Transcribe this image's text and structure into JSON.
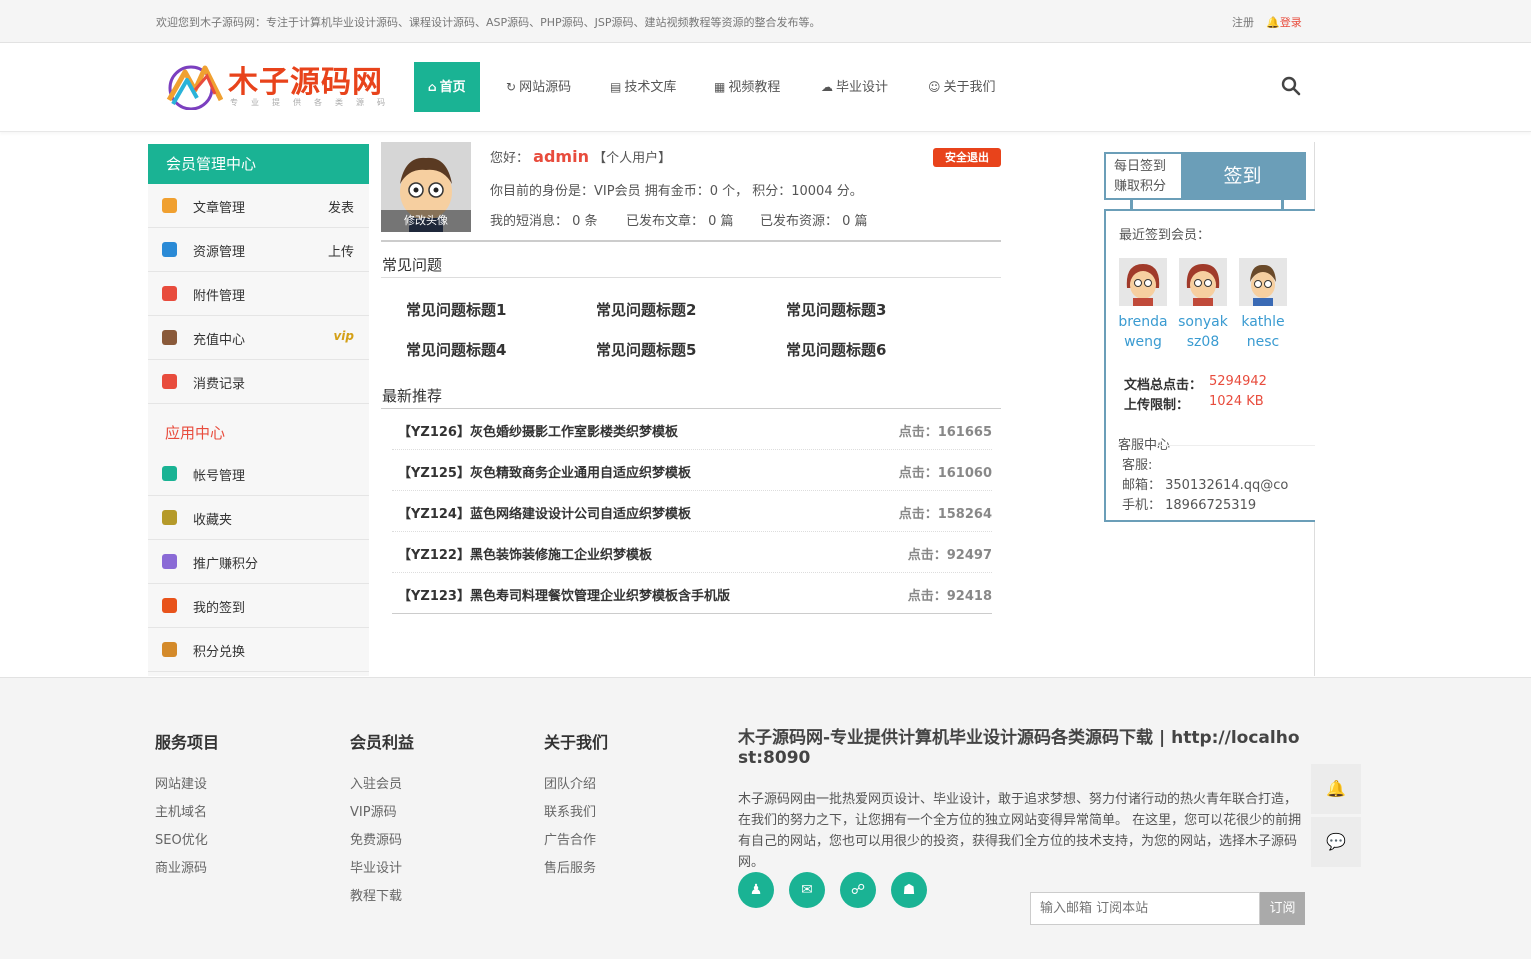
{
  "topbar": {
    "welcome": "欢迎您到木子源码网：专注于计算机毕业设计源码、课程设计源码、ASP源码、PHP源码、JSP源码、建站视频教程等资源的整合发布等。",
    "register": "注册",
    "login": "登录"
  },
  "header": {
    "logo_text": "木子源码网",
    "logo_sub": "专业提供各类源码",
    "nav": [
      {
        "label": "首页",
        "icon": "home-icon"
      },
      {
        "label": "网站源码",
        "icon": "refresh-icon"
      },
      {
        "label": "技术文库",
        "icon": "file-icon"
      },
      {
        "label": "视频教程",
        "icon": "film-icon"
      },
      {
        "label": "毕业设计",
        "icon": "cloud-icon"
      },
      {
        "label": "关于我们",
        "icon": "smile-icon"
      }
    ]
  },
  "sidebar": {
    "title": "会员管理中心",
    "items": [
      {
        "label": "文章管理",
        "right": "发表",
        "color": "#f0a030"
      },
      {
        "label": "资源管理",
        "right": "上传",
        "color": "#2a8ad6"
      },
      {
        "label": "附件管理",
        "right": "",
        "color": "#e84c3d"
      },
      {
        "label": "充值中心",
        "right": "vip",
        "color": "#8a5a3a"
      },
      {
        "label": "消费记录",
        "right": "",
        "color": "#e84c3d"
      }
    ],
    "app_title": "应用中心",
    "app_items": [
      {
        "label": "帐号管理",
        "color": "#1ab394"
      },
      {
        "label": "收藏夹",
        "color": "#b59a2a"
      },
      {
        "label": "推广赚积分",
        "color": "#8a6ad6"
      },
      {
        "label": "我的签到",
        "color": "#e8531b"
      },
      {
        "label": "积分兑换",
        "color": "#d48a2a"
      }
    ]
  },
  "profile": {
    "avatar_caption": "修改头像",
    "greeting": "您好：",
    "username": "admin",
    "user_type": "【个人用户】",
    "logout": "安全退出",
    "identity_line": "你目前的身份是：VIP会员 拥有金币：0 个， 积分：10004 分。",
    "messages": "我的短消息： 0 条",
    "articles": "已发布文章： 0 篇",
    "resources": "已发布资源： 0 篇"
  },
  "faq": {
    "title": "常见问题",
    "items": [
      "常见问题标题1",
      "常见问题标题2",
      "常见问题标题3",
      "常见问题标题4",
      "常见问题标题5",
      "常见问题标题6"
    ]
  },
  "recommend": {
    "title": "最新推荐",
    "rows": [
      {
        "title": "【YZ126】灰色婚纱摄影工作室影楼类织梦模板",
        "clicks": "点击：161665"
      },
      {
        "title": "【YZ125】灰色精致商务企业通用自适应织梦模板",
        "clicks": "点击：161060"
      },
      {
        "title": "【YZ124】蓝色网络建设设计公司自适应织梦模板",
        "clicks": "点击：158264"
      },
      {
        "title": "【YZ122】黑色装饰装修施工企业织梦模板",
        "clicks": "点击：92497"
      },
      {
        "title": "【YZ123】黑色寿司料理餐饮管理企业织梦模板含手机版",
        "clicks": "点击：92418"
      }
    ]
  },
  "signin": {
    "left_line1": "每日签到",
    "left_line2": "赚取积分",
    "button": "签到",
    "recent_title": "最近签到会员：",
    "members": [
      {
        "line1": "brenda",
        "line2": "weng"
      },
      {
        "line1": "sonyak",
        "line2": "sz08"
      },
      {
        "line1": "kathle",
        "line2": "nesc"
      }
    ],
    "stats": [
      {
        "label": "文档总点击：",
        "value": "5294942"
      },
      {
        "label": "上传限制：",
        "value": "1024 KB"
      }
    ],
    "service_title": "客服中心",
    "service_kf": "客服:",
    "service_email": "邮箱： 350132614.qq@co",
    "service_phone": "手机： 18966725319"
  },
  "footer": {
    "cols": [
      {
        "title": "服务项目",
        "links": [
          "网站建设",
          "主机域名",
          "SEO优化",
          "商业源码"
        ]
      },
      {
        "title": "会员利益",
        "links": [
          "入驻会员",
          "VIP源码",
          "免费源码",
          "毕业设计",
          "教程下载"
        ]
      },
      {
        "title": "关于我们",
        "links": [
          "团队介绍",
          "联系我们",
          "广告合作",
          "售后服务"
        ]
      }
    ],
    "about_title": "木子源码网-专业提供计算机毕业设计源码各类源码下载 | http://localhost:8090",
    "about_text": "木子源码网由一批热爱网页设计、毕业设计，敢于追求梦想、努力付诸行动的热火青年联合打造，在我们的努力之下，让您拥有一个全方位的独立网站变得异常简单。 在这里，您可以花很少的前拥有自己的网站，您也可以用很少的投资，获得我们全方位的技术支持，为您的网站，选择木子源码网。",
    "subscribe_placeholder": "输入邮箱 订阅本站",
    "subscribe_button": "订阅"
  },
  "colors": {
    "accent": "#1ab394",
    "red": "#e84c3d",
    "signin_blue": "#6b9eb8"
  }
}
